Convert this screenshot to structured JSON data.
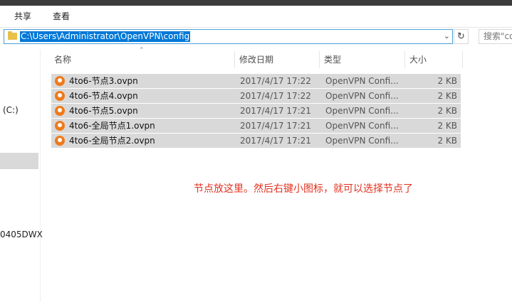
{
  "ribbon": {
    "tabs": [
      "共享",
      "查看"
    ]
  },
  "address": {
    "path": "C:\\Users\\Administrator\\OpenVPN\\config"
  },
  "search": {
    "placeholder": "搜索\"co"
  },
  "nav": {
    "drive_label": "(C:)",
    "device_label": "0405DWX"
  },
  "columns": {
    "name": "名称",
    "modified": "修改日期",
    "type": "类型",
    "size": "大小"
  },
  "files": [
    {
      "name": "4to6-节点3.ovpn",
      "modified": "2017/4/17 17:22",
      "type": "OpenVPN Confi...",
      "size": "2 KB"
    },
    {
      "name": "4to6-节点4.ovpn",
      "modified": "2017/4/17 17:22",
      "type": "OpenVPN Confi...",
      "size": "2 KB"
    },
    {
      "name": "4to6-节点5.ovpn",
      "modified": "2017/4/17 17:21",
      "type": "OpenVPN Confi...",
      "size": "2 KB"
    },
    {
      "name": "4to6-全局节点1.ovpn",
      "modified": "2017/4/17 17:21",
      "type": "OpenVPN Confi...",
      "size": "2 KB"
    },
    {
      "name": "4to6-全局节点2.ovpn",
      "modified": "2017/4/17 17:21",
      "type": "OpenVPN Confi...",
      "size": "2 KB"
    }
  ],
  "annotation": "节点放这里。然后右键小图标，就可以选择节点了",
  "icons": {
    "folder": "folder-icon",
    "refresh": "refresh-icon",
    "dropdown": "chevron-down-icon",
    "file": "openvpn-file-icon"
  },
  "colors": {
    "selection": "#0078d7",
    "row_highlight": "#d9d9d9",
    "note": "#e0311f",
    "openvpn_orange": "#ef7a1a"
  }
}
